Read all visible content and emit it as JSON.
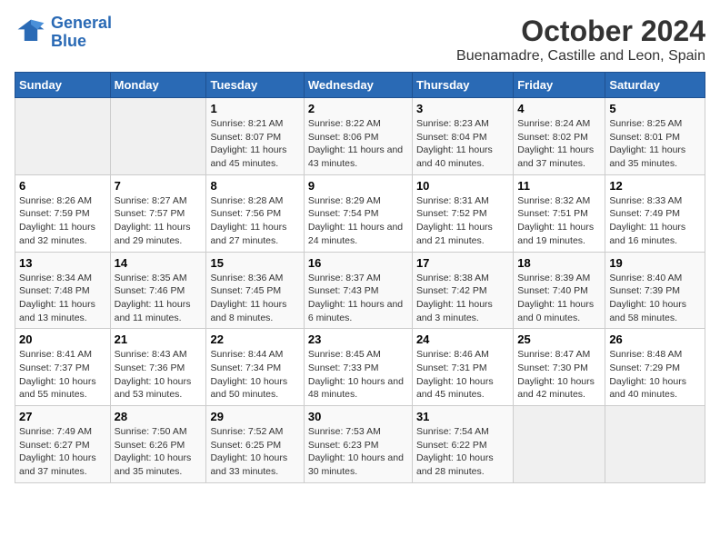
{
  "logo": {
    "line1": "General",
    "line2": "Blue"
  },
  "title": "October 2024",
  "subtitle": "Buenamadre, Castille and Leon, Spain",
  "headers": [
    "Sunday",
    "Monday",
    "Tuesday",
    "Wednesday",
    "Thursday",
    "Friday",
    "Saturday"
  ],
  "weeks": [
    [
      {
        "day": "",
        "info": ""
      },
      {
        "day": "",
        "info": ""
      },
      {
        "day": "1",
        "info": "Sunrise: 8:21 AM\nSunset: 8:07 PM\nDaylight: 11 hours and 45 minutes."
      },
      {
        "day": "2",
        "info": "Sunrise: 8:22 AM\nSunset: 8:06 PM\nDaylight: 11 hours and 43 minutes."
      },
      {
        "day": "3",
        "info": "Sunrise: 8:23 AM\nSunset: 8:04 PM\nDaylight: 11 hours and 40 minutes."
      },
      {
        "day": "4",
        "info": "Sunrise: 8:24 AM\nSunset: 8:02 PM\nDaylight: 11 hours and 37 minutes."
      },
      {
        "day": "5",
        "info": "Sunrise: 8:25 AM\nSunset: 8:01 PM\nDaylight: 11 hours and 35 minutes."
      }
    ],
    [
      {
        "day": "6",
        "info": "Sunrise: 8:26 AM\nSunset: 7:59 PM\nDaylight: 11 hours and 32 minutes."
      },
      {
        "day": "7",
        "info": "Sunrise: 8:27 AM\nSunset: 7:57 PM\nDaylight: 11 hours and 29 minutes."
      },
      {
        "day": "8",
        "info": "Sunrise: 8:28 AM\nSunset: 7:56 PM\nDaylight: 11 hours and 27 minutes."
      },
      {
        "day": "9",
        "info": "Sunrise: 8:29 AM\nSunset: 7:54 PM\nDaylight: 11 hours and 24 minutes."
      },
      {
        "day": "10",
        "info": "Sunrise: 8:31 AM\nSunset: 7:52 PM\nDaylight: 11 hours and 21 minutes."
      },
      {
        "day": "11",
        "info": "Sunrise: 8:32 AM\nSunset: 7:51 PM\nDaylight: 11 hours and 19 minutes."
      },
      {
        "day": "12",
        "info": "Sunrise: 8:33 AM\nSunset: 7:49 PM\nDaylight: 11 hours and 16 minutes."
      }
    ],
    [
      {
        "day": "13",
        "info": "Sunrise: 8:34 AM\nSunset: 7:48 PM\nDaylight: 11 hours and 13 minutes."
      },
      {
        "day": "14",
        "info": "Sunrise: 8:35 AM\nSunset: 7:46 PM\nDaylight: 11 hours and 11 minutes."
      },
      {
        "day": "15",
        "info": "Sunrise: 8:36 AM\nSunset: 7:45 PM\nDaylight: 11 hours and 8 minutes."
      },
      {
        "day": "16",
        "info": "Sunrise: 8:37 AM\nSunset: 7:43 PM\nDaylight: 11 hours and 6 minutes."
      },
      {
        "day": "17",
        "info": "Sunrise: 8:38 AM\nSunset: 7:42 PM\nDaylight: 11 hours and 3 minutes."
      },
      {
        "day": "18",
        "info": "Sunrise: 8:39 AM\nSunset: 7:40 PM\nDaylight: 11 hours and 0 minutes."
      },
      {
        "day": "19",
        "info": "Sunrise: 8:40 AM\nSunset: 7:39 PM\nDaylight: 10 hours and 58 minutes."
      }
    ],
    [
      {
        "day": "20",
        "info": "Sunrise: 8:41 AM\nSunset: 7:37 PM\nDaylight: 10 hours and 55 minutes."
      },
      {
        "day": "21",
        "info": "Sunrise: 8:43 AM\nSunset: 7:36 PM\nDaylight: 10 hours and 53 minutes."
      },
      {
        "day": "22",
        "info": "Sunrise: 8:44 AM\nSunset: 7:34 PM\nDaylight: 10 hours and 50 minutes."
      },
      {
        "day": "23",
        "info": "Sunrise: 8:45 AM\nSunset: 7:33 PM\nDaylight: 10 hours and 48 minutes."
      },
      {
        "day": "24",
        "info": "Sunrise: 8:46 AM\nSunset: 7:31 PM\nDaylight: 10 hours and 45 minutes."
      },
      {
        "day": "25",
        "info": "Sunrise: 8:47 AM\nSunset: 7:30 PM\nDaylight: 10 hours and 42 minutes."
      },
      {
        "day": "26",
        "info": "Sunrise: 8:48 AM\nSunset: 7:29 PM\nDaylight: 10 hours and 40 minutes."
      }
    ],
    [
      {
        "day": "27",
        "info": "Sunrise: 7:49 AM\nSunset: 6:27 PM\nDaylight: 10 hours and 37 minutes."
      },
      {
        "day": "28",
        "info": "Sunrise: 7:50 AM\nSunset: 6:26 PM\nDaylight: 10 hours and 35 minutes."
      },
      {
        "day": "29",
        "info": "Sunrise: 7:52 AM\nSunset: 6:25 PM\nDaylight: 10 hours and 33 minutes."
      },
      {
        "day": "30",
        "info": "Sunrise: 7:53 AM\nSunset: 6:23 PM\nDaylight: 10 hours and 30 minutes."
      },
      {
        "day": "31",
        "info": "Sunrise: 7:54 AM\nSunset: 6:22 PM\nDaylight: 10 hours and 28 minutes."
      },
      {
        "day": "",
        "info": ""
      },
      {
        "day": "",
        "info": ""
      }
    ]
  ]
}
